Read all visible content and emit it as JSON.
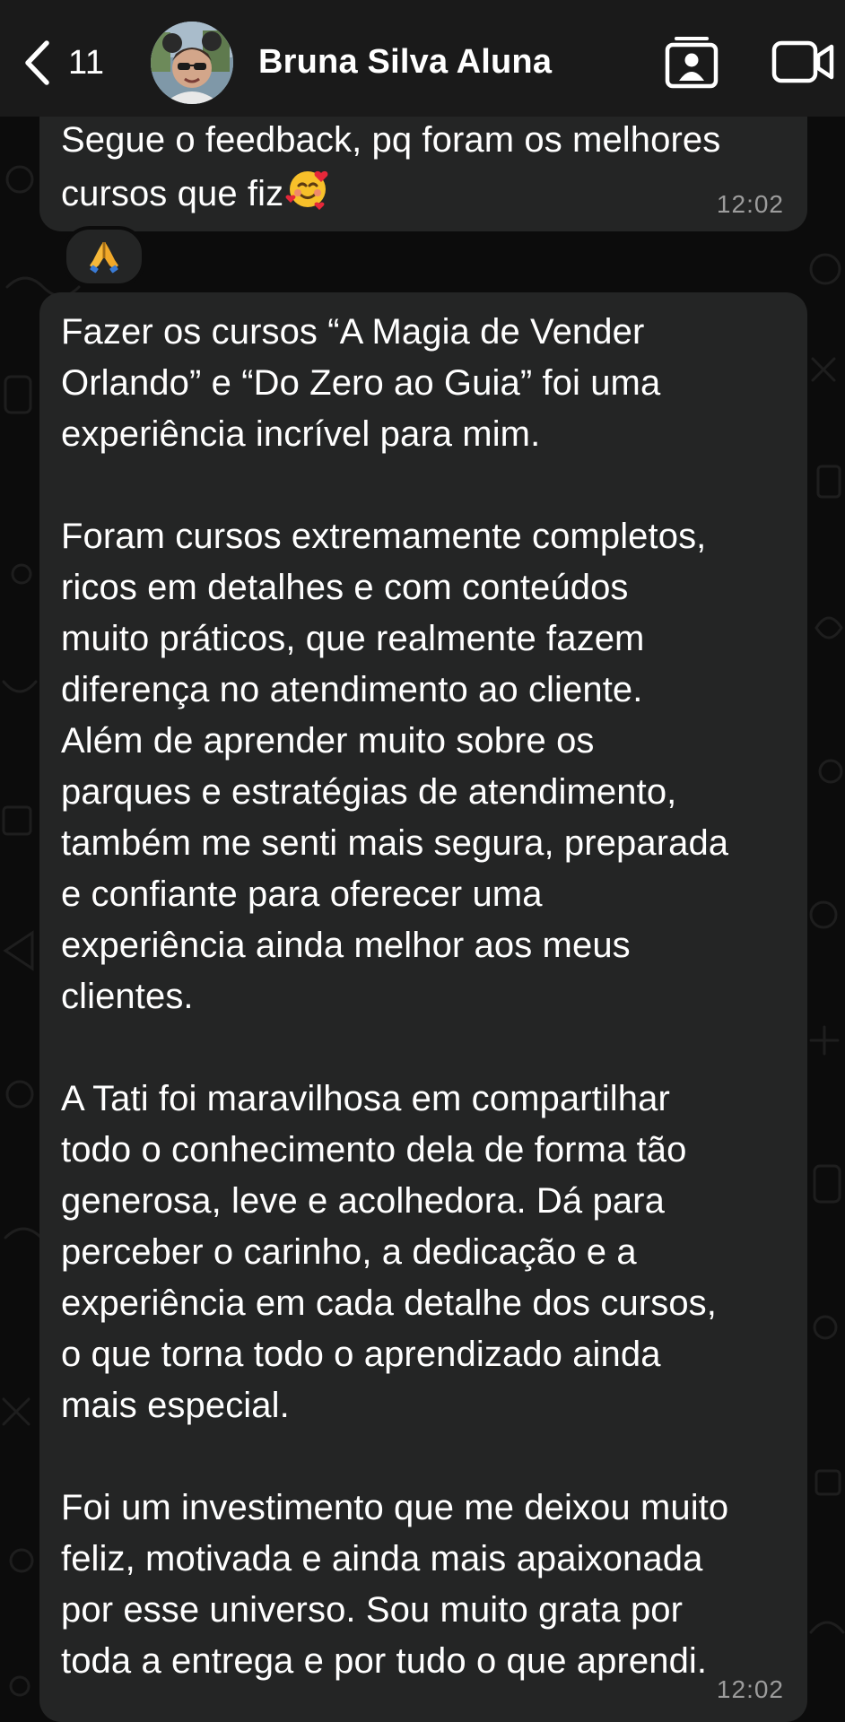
{
  "header": {
    "back_count": "11",
    "contact_name": "Bruna Silva Aluna",
    "icons": {
      "back": "chevron-left-icon",
      "avatar": "contact-avatar",
      "contact_card": "contact-card-icon",
      "video": "video-camera-icon"
    }
  },
  "messages": [
    {
      "text": "Segue o feedback, pq foram os melhores\ncursos que fiz",
      "emoji": "smiling-face-with-hearts",
      "time": "12:02",
      "reaction": "folded-hands"
    },
    {
      "text": "Fazer os cursos “A Magia de Vender\nOrlando” e “Do Zero ao Guia” foi uma\nexperiência incrível para mim.\n\nForam cursos extremamente completos,\nricos em detalhes e com conteúdos\nmuito práticos, que realmente fazem\ndiferença no atendimento ao cliente.\nAlém de aprender muito sobre os\nparques e estratégias de atendimento,\ntambém me senti mais segura, preparada\ne confiante para oferecer uma\nexperiência ainda melhor aos meus\nclientes.\n\nA Tati foi maravilhosa em compartilhar\ntodo o conhecimento dela de forma tão\ngenerosa, leve e acolhedora. Dá para\nperceber o carinho, a dedicação e a\nexperiência em cada detalhe dos cursos,\no que torna todo o aprendizado ainda\nmais especial.\n\nFoi um investimento que me deixou muito\nfeliz, motivada e ainda mais apaixonada\npor esse universo. Sou muito grata por\ntoda a entrega e por tudo o que aprendi.",
      "time": "12:02"
    }
  ],
  "colors": {
    "background": "#0c0c0c",
    "header": "#1a1a1a",
    "bubble": "#242525",
    "text": "#ffffff",
    "timestamp": "#9c9c9c"
  }
}
